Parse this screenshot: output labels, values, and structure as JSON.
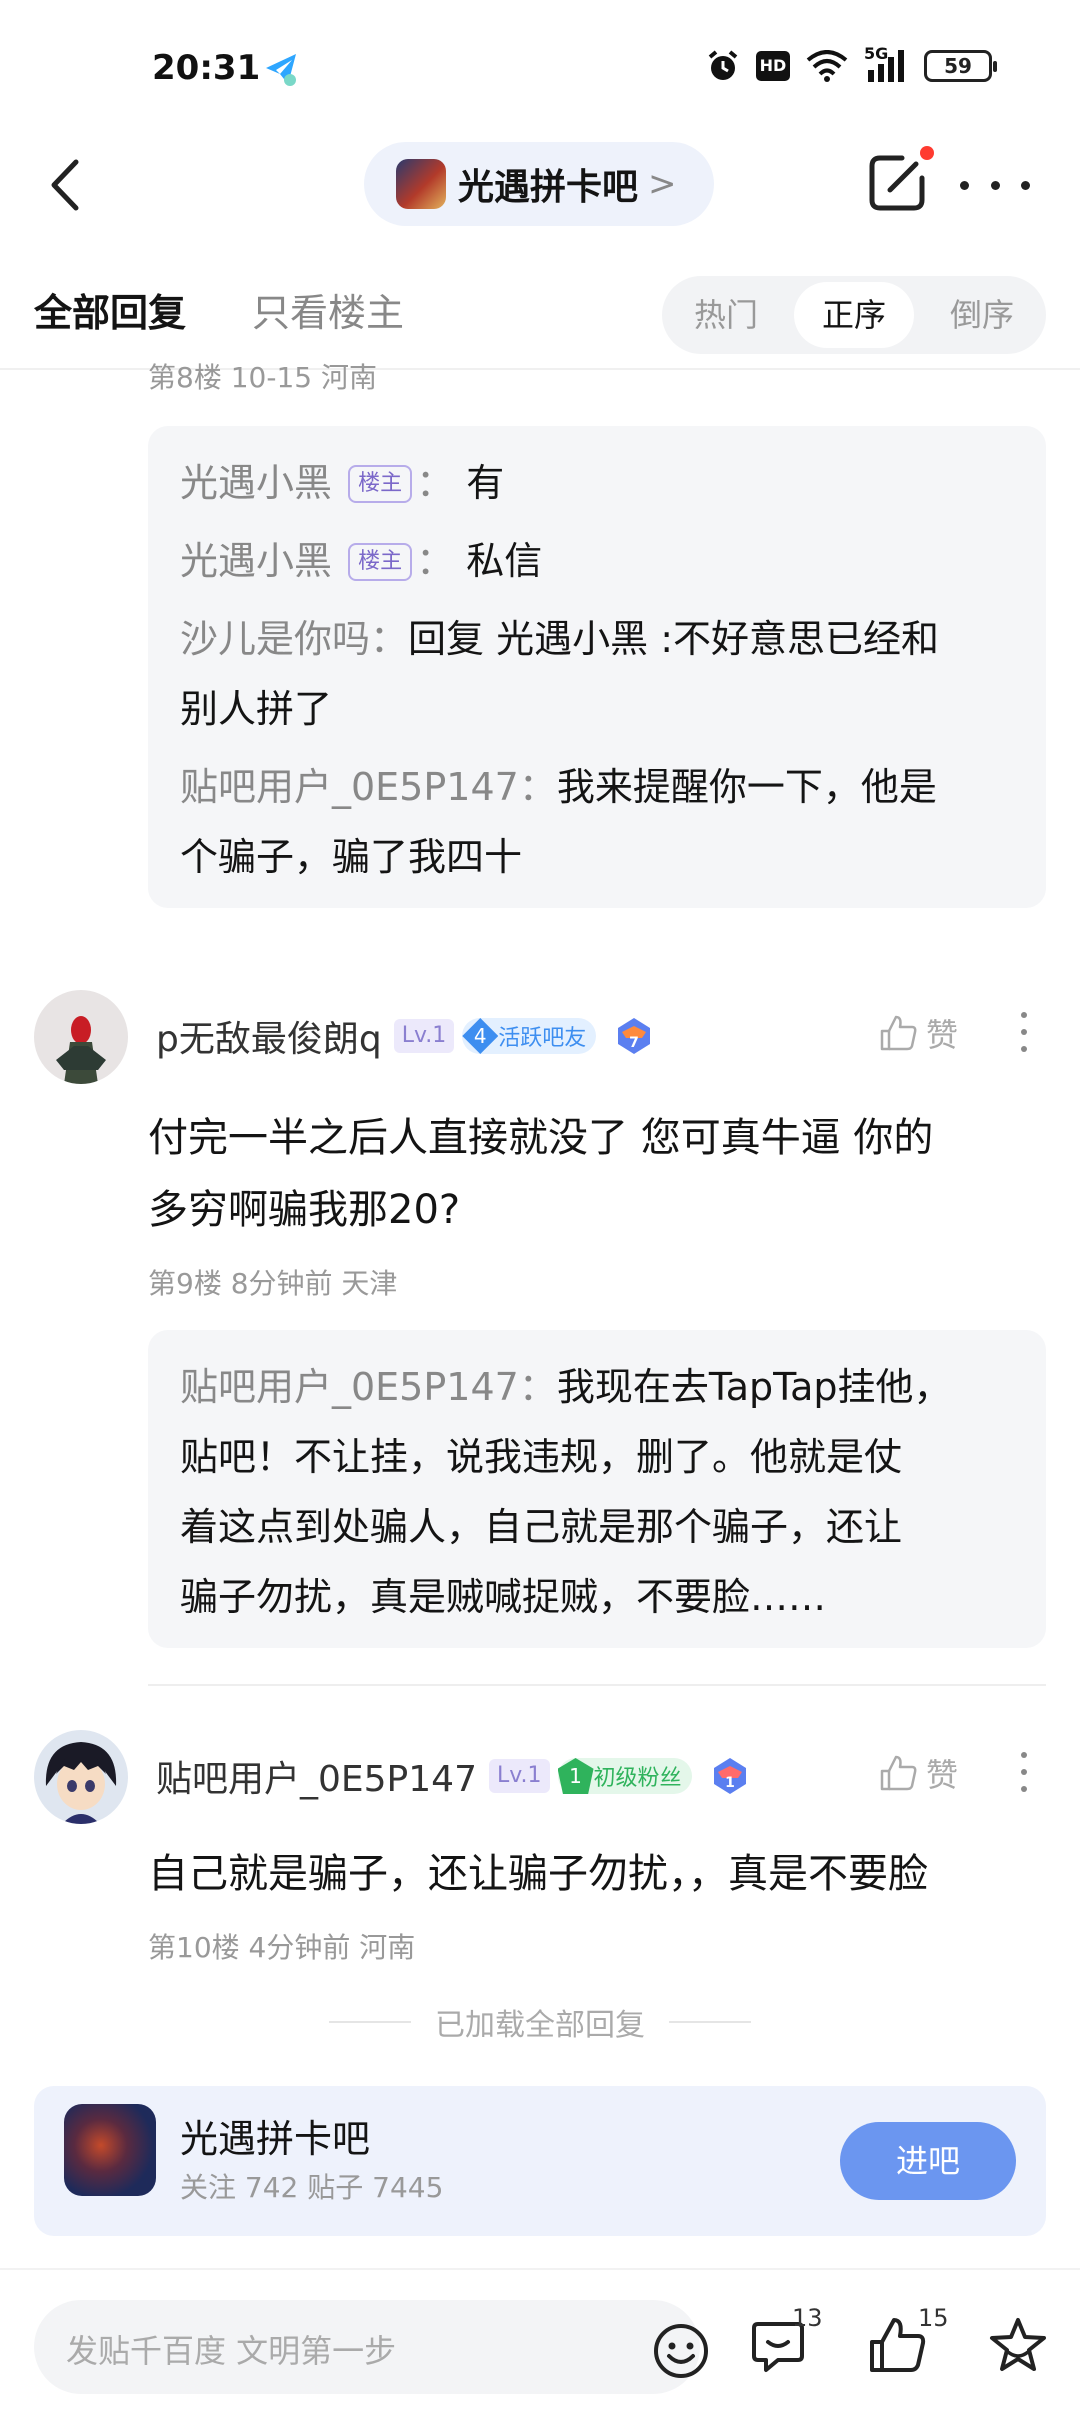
{
  "status_bar": {
    "time": "20:31",
    "battery": "59",
    "hd": "HD",
    "network": "5G",
    "icons": [
      "app-notify-icon",
      "alarm-icon",
      "hd-icon",
      "wifi-icon",
      "signal-5g-icon",
      "battery-icon"
    ]
  },
  "nav": {
    "forum_name": "光遇拼卡吧",
    "chevron": ">",
    "has_notification_dot": true
  },
  "filter": {
    "tab_all": "全部回复",
    "tab_op_only": "只看楼主",
    "sort_hot": "热门",
    "sort_asc": "正序",
    "sort_desc": "倒序",
    "selected_sort": "正序"
  },
  "post8": {
    "meta": "第8楼  10-15  河南",
    "replies": [
      {
        "user": "光遇小黑",
        "is_op": true,
        "op_label": "楼主",
        "sep": "：",
        "text": "有"
      },
      {
        "user": "光遇小黑",
        "is_op": true,
        "op_label": "楼主",
        "sep": "：",
        "text": "私信"
      },
      {
        "user": "沙儿是你吗",
        "sep": "：",
        "text_line1": "回复 光遇小黑 :不好意思已经和",
        "text_line2": "别人拼了"
      },
      {
        "user": "贴吧用户_0E5P147",
        "sep": "：",
        "text_line1": "我来提醒你一下，他是",
        "text_line2": "个骗子，骗了我四十"
      }
    ]
  },
  "post9": {
    "username": "p无敌最俊朗q",
    "level": "Lv.1",
    "badge_num": "4",
    "badge_text": "活跃吧友",
    "rank": "7",
    "like_label": "赞",
    "text_line1": "付完一半之后人直接就没了 您可真牛逼 你的",
    "text_line2": "多穷啊骗我那20?",
    "meta": "第9楼  8分钟前  天津",
    "reply": {
      "user": "贴吧用户_0E5P147",
      "sep": "：",
      "line1": "我现在去TapTap挂他，",
      "line2": "贴吧！不让挂，说我违规，删了。他就是仗",
      "line3": "着这点到处骗人，自己就是那个骗子，还让",
      "line4": "骗子勿扰，真是贼喊捉贼，不要脸……"
    }
  },
  "post10": {
    "username": "贴吧用户_0E5P147",
    "level": "Lv.1",
    "badge_num": "1",
    "badge_text": "初级粉丝",
    "rank": "1",
    "like_label": "赞",
    "text": "自己就是骗子，还让骗子勿扰，，真是不要脸",
    "meta": "第10楼  4分钟前  河南"
  },
  "loaded_text": "已加载全部回复",
  "forum_card": {
    "name": "光遇拼卡吧",
    "stats": "关注 742  贴子 7445",
    "join_label": "进吧"
  },
  "bottom_bar": {
    "placeholder": "发贴千百度 文明第一步",
    "comment_count": "13",
    "like_count": "15"
  },
  "colors": {
    "accent": "#6b96f0",
    "op_badge": "#7b68c9",
    "active_badge": "#3d8ef0",
    "fan_badge": "#2fb35c",
    "notification": "#ff3b30"
  }
}
